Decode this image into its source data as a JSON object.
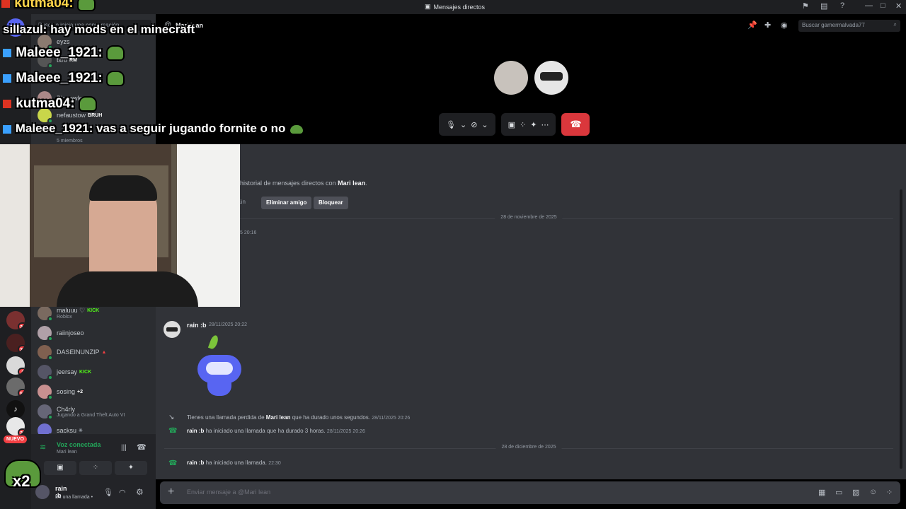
{
  "titlebar": {
    "title": "Mensajes directos",
    "icons": [
      "inbox-icon",
      "screen-icon",
      "help-icon"
    ],
    "window_controls": [
      "—",
      "□",
      "✕"
    ]
  },
  "rail": {
    "badges": [
      "20",
      "29",
      "1",
      "52",
      "37"
    ],
    "nuevo": "NUEVO"
  },
  "dm_sidebar": {
    "search_placeholder": "Busca o inicia una conversación",
    "members_top": [
      {
        "name": "eyzs"
      },
      {
        "name": "txro",
        "tag": "RM"
      },
      {
        "name": "Bkcrowle"
      },
      {
        "name": "nefaustow",
        "tag": "BRUH"
      }
    ],
    "members_count": "5 miembros",
    "members_bottom": [
      {
        "name": "maluuu ♡",
        "tag": "KICK",
        "sub": "Roblox"
      },
      {
        "name": "raiinjoseo",
        "tag": "",
        "sub": ""
      },
      {
        "name": "DASEINUNZIP",
        "tag": "▲",
        "sub": ""
      },
      {
        "name": "jeersay",
        "tag": "KICK",
        "sub": ""
      },
      {
        "name": "sosing",
        "tag": "+2",
        "sub": ""
      },
      {
        "name": "Ch4rly",
        "tag": "",
        "sub": "Jugando a Grand Theft Auto VI"
      },
      {
        "name": "sacksu",
        "tag": "✳",
        "sub": ""
      }
    ]
  },
  "voice_panel": {
    "status": "Voz conectada",
    "sub": "Mari lean",
    "user_name": "rain :b",
    "user_status": "En una llamada •"
  },
  "header": {
    "dm_title": "Mari lean",
    "search_placeholder": "Buscar gamermalvada77"
  },
  "chat": {
    "intro_text_prefix": "historial de mensajes directos con ",
    "intro_text_name": "Mari lean",
    "intro_buttons": {
      "common": "ún",
      "remove_friend": "Eliminar amigo",
      "block": "Bloquear"
    },
    "date_1": "28 de noviembre de 2025",
    "early_time": "5 20:16",
    "message": {
      "author": "rain :b",
      "timestamp": "28/11/2025 20:22"
    },
    "system_1": {
      "prefix": "Tienes una llamada perdida de ",
      "name": "Mari lean",
      "suffix": " que ha durado unos segundos.",
      "time": "28/11/2025 20:26"
    },
    "system_2": {
      "name": "rain :b",
      "text": " ha iniciado una llamada que ha durado 3 horas.",
      "time": "28/11/2025 20:26"
    },
    "date_2": "28 de diciembre de 2025",
    "system_3": {
      "name": "rain :b",
      "text": " ha iniciado una llamada.",
      "time": "22:30"
    },
    "composer_placeholder": "Enviar mensaje a @Mari lean"
  },
  "overlay_chat": [
    {
      "user": "kutma04:",
      "text": ""
    },
    {
      "user": "sillazul:",
      "text": " hay mods en el minecraft"
    },
    {
      "user": "Maleee_1921:",
      "text": ""
    },
    {
      "user": "Maleee_1921:",
      "text": ""
    },
    {
      "user": "kutma04:",
      "text": ""
    },
    {
      "user": "Maleee_1921:",
      "text": " vas a seguir jugando fornite o no"
    }
  ],
  "overlay_x2": "x2",
  "colors": {
    "accent_green": "#23a559",
    "hangup_red": "#da373c",
    "badge_red": "#f23f43"
  }
}
